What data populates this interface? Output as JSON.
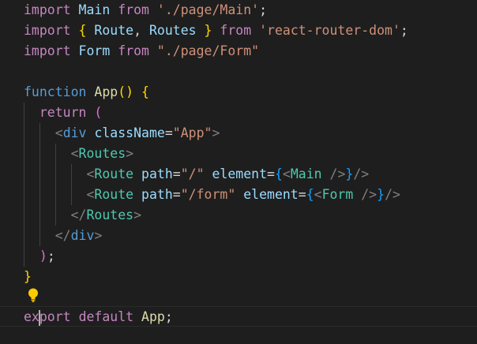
{
  "code": {
    "imports": [
      {
        "keyword": "import",
        "name": "Main",
        "from": "from",
        "source": "'./page/Main'",
        "end": ";"
      },
      {
        "keyword": "import",
        "open": "{",
        "names": [
          "Route",
          "Routes"
        ],
        "close": "}",
        "from": "from",
        "source": "'react-router-dom'",
        "end": ";"
      },
      {
        "keyword": "import",
        "name": "Form",
        "from": "from",
        "source": "\"./page/Form\""
      }
    ],
    "func": {
      "keyword": "function",
      "name": "App",
      "params": "()",
      "open_brace": "{",
      "close_brace": "}",
      "return_kw": "return",
      "return_open": "(",
      "return_close": ")",
      "semi": ";"
    },
    "div": {
      "tag": "div",
      "attr": "className",
      "value": "\"App\""
    },
    "routes_tag": "Routes",
    "route_tag": "Route",
    "route_attr_path": "path",
    "route_attr_element": "element",
    "routes": [
      {
        "path": "\"/\"",
        "component": "Main"
      },
      {
        "path": "\"/form\"",
        "component": "Form"
      }
    ],
    "export": {
      "kw1_before_cursor": "ex",
      "kw1_after_cursor": "port",
      "kw2": "default",
      "name": "App",
      "semi": ";"
    }
  },
  "colors": {
    "background": "#1e1e1e",
    "keyword_control": "#c586c0",
    "keyword": "#569cd6",
    "function": "#dcdcaa",
    "variable": "#9cdcfe",
    "string": "#ce9178",
    "tag": "#4ec9b0",
    "bracket_gold": "#ffd700",
    "bracket_orchid": "#da70d6",
    "bracket_blue": "#179fff"
  },
  "icons": [
    "lightbulb-icon"
  ]
}
